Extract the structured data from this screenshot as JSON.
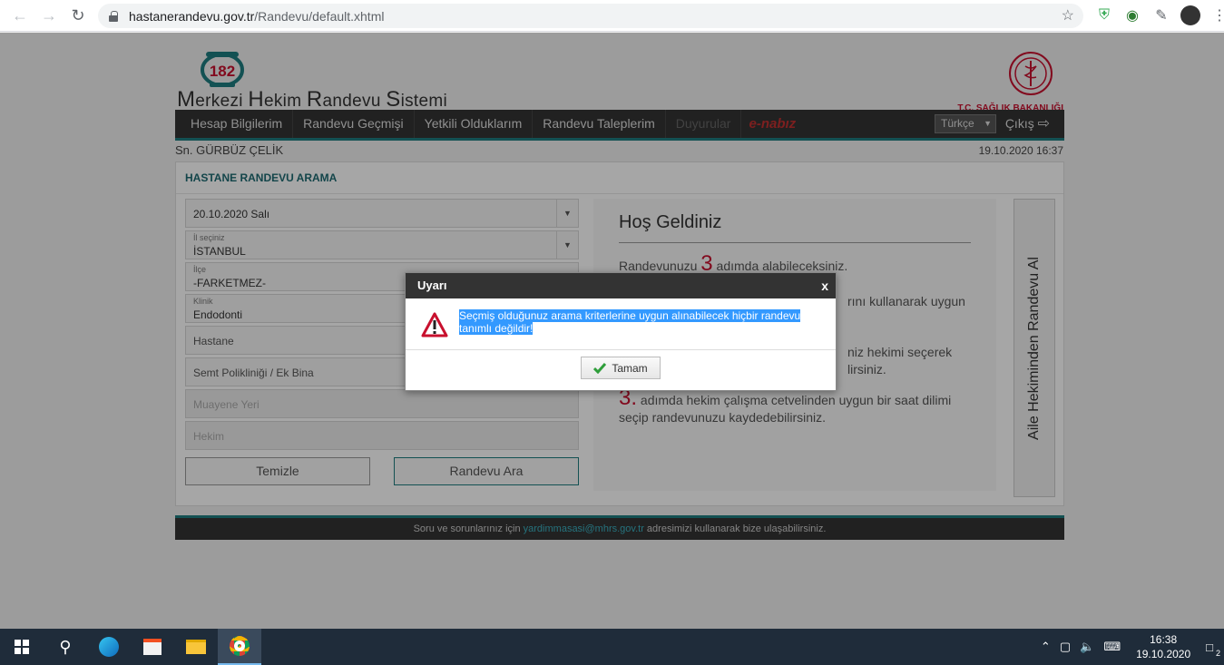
{
  "browser": {
    "url_host": "hastanerandevu.gov.tr",
    "url_path": "/Randevu/default.xhtml"
  },
  "site": {
    "logo_number": "182",
    "title_parts": [
      "M",
      "erkezi ",
      "H",
      "ekim ",
      "R",
      "andevu ",
      "S",
      "istemi"
    ],
    "ministry": "T.C. SAĞLIK BAKANLIĞI"
  },
  "menu": {
    "items": [
      "Hesap Bilgilerim",
      "Randevu Geçmişi",
      "Yetkili Olduklarım",
      "Randevu Taleplerim",
      "Duyurular"
    ],
    "enabiz": "e-nabız",
    "language": "Türkçe",
    "logout": "Çıkış"
  },
  "user": {
    "name": "Sn. GÜRBÜZ ÇELİK",
    "datetime": "19.10.2020 16:37"
  },
  "search": {
    "title": "HASTANE RANDEVU ARAMA",
    "date": "20.10.2020 Salı",
    "il_label": "İl seçiniz",
    "il_value": "İSTANBUL",
    "ilce_label": "İlçe",
    "ilce_value": "-FARKETMEZ-",
    "klinik_label": "Klinik",
    "klinik_value": "Endodonti",
    "hastane_ph": "Hastane",
    "semt_ph": "Semt Polikliniği / Ek Bina",
    "muayene_ph": "Muayene Yeri",
    "hekim_ph": "Hekim",
    "clear_label": "Temizle",
    "search_label": "Randevu Ara"
  },
  "welcome": {
    "title": "Hoş Geldiniz",
    "line1_pre": "Randevunuzu ",
    "line1_num": "3",
    "line1_post": " adımda alabileceksiniz.",
    "line2": "rını kullanarak uygun",
    "line3a": "niz hekimi seçerek",
    "line3b": "lirsiniz.",
    "line4_num": "3.",
    "line4": " adımda hekim çalışma cetvelinden uygun bir saat dilimi seçip randevunuzu kaydedebilirsiniz.",
    "side_tab": "Aile Hekiminden Randevu Al"
  },
  "footer": {
    "pre": "Soru ve sorunlarınız için ",
    "email": "yardimmasasi@mhrs.gov.tr",
    "post": " adresimizi kullanarak bize ulaşabilirsiniz."
  },
  "dialog": {
    "title": "Uyarı",
    "close": "x",
    "message_line1": "Seçmiş olduğunuz arama kriterlerine uygun alınabilecek hiçbir randevu",
    "message_line2": "tanımlı değildir!",
    "ok_label": "Tamam"
  },
  "taskbar": {
    "time": "16:38",
    "date": "19.10.2020",
    "notifications": "2"
  }
}
